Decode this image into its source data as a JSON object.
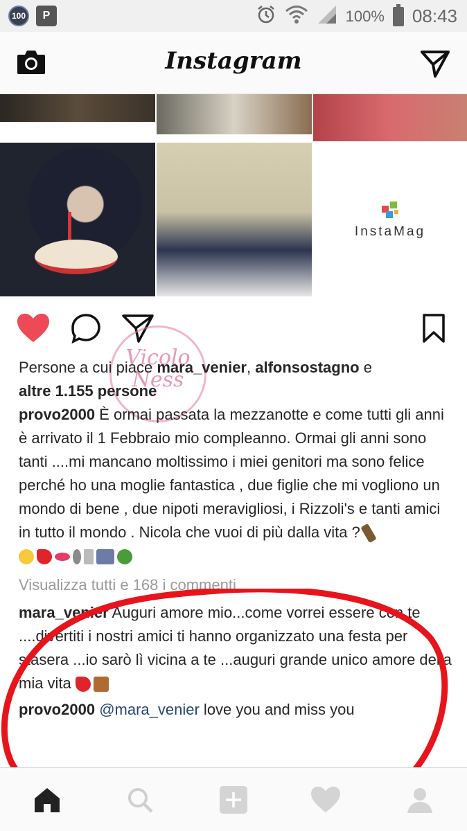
{
  "status_bar": {
    "badge": "100",
    "app_icon": "P",
    "battery_percent": "100%",
    "time": "08:43",
    "icons": [
      "alarm-icon",
      "wifi-icon",
      "signal-icon",
      "battery-icon"
    ]
  },
  "header": {
    "title": "Instagram",
    "left_icon": "camera-icon",
    "right_icon": "direct-send-icon"
  },
  "collage": {
    "watermark_text": "InstaMag"
  },
  "post": {
    "actions": [
      "like-icon",
      "comment-icon",
      "share-icon",
      "save-icon"
    ],
    "liked": true,
    "likes_prefix": "Persone a cui piace ",
    "likes_user1": "mara_venier",
    "likes_sep": ", ",
    "likes_user2": "alfonsostagno",
    "likes_and": " e",
    "likes_others": "altre 1.155 persone",
    "caption_user": "provo2000",
    "caption_text": " È ormai passata la mezzanotte e come tutti gli anni è arrivato il 1 Febbraio mio compleanno. Ormai gli anni sono tanti ....mi mancano moltissimo i miei genitori ma sono felice perché ho una moglie fantastica , due figlie che mi vogliono un mondo di bene , due nipoti meravigliosi, i Rizzoli's e tanti amici in tutto il mondo . Nicola che vuoi di più dalla vita ?",
    "view_comments": "Visualizza tutti e 168 i commenti",
    "comments": [
      {
        "user": "mara_venier",
        "text": " Auguri amore mio...come vorrei essere con te ....divertiti i nostri amici ti hanno organizzato una festa per stasera ...io sarò lì vicina a te ...auguri grande unico amore della mia vita"
      },
      {
        "user": "provo2000",
        "mention": "@mara_venier",
        "text": " love you and miss you"
      }
    ]
  },
  "bottom_nav": {
    "items": [
      "home-icon",
      "search-icon",
      "add-icon",
      "activity-icon",
      "profile-icon"
    ],
    "active": "home-icon"
  },
  "colors": {
    "like_red": "#ed4956",
    "text": "#262626",
    "muted": "#9a9a9a",
    "mention": "#27466f",
    "annotation_red": "#e8141c"
  }
}
